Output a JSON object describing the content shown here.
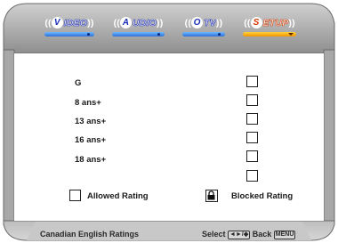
{
  "tabs": [
    {
      "paren_left": "((",
      "cap": "V",
      "rest": "IDEO",
      "paren_right": "))",
      "active": false
    },
    {
      "paren_left": "((",
      "cap": "A",
      "rest": "UDIO",
      "paren_right": "))",
      "active": false
    },
    {
      "paren_left": "((",
      "cap": "O",
      "rest": "TV",
      "paren_right": "))",
      "active": false
    },
    {
      "paren_left": "((",
      "cap": "S",
      "rest": "ETUP",
      "paren_right": "))",
      "active": true
    }
  ],
  "ratings": [
    {
      "label": "G",
      "blocked": false
    },
    {
      "label": "8 ans+",
      "blocked": false
    },
    {
      "label": "13 ans+",
      "blocked": false
    },
    {
      "label": "16 ans+",
      "blocked": false
    },
    {
      "label": "18 ans+",
      "blocked": false
    },
    {
      "label": "",
      "blocked": false
    }
  ],
  "legend": {
    "allowed": "Allowed Rating",
    "blocked": "Blocked Rating"
  },
  "footer": {
    "title": "Canadian English Ratings",
    "select_text": "Select",
    "select_keys": "◄►/◆",
    "back_text": "Back",
    "back_key": "MENU"
  },
  "colors": {
    "bezel": "#a9a9a9",
    "tab_blue": "#2c6fd8",
    "tab_active": "#f39400"
  }
}
